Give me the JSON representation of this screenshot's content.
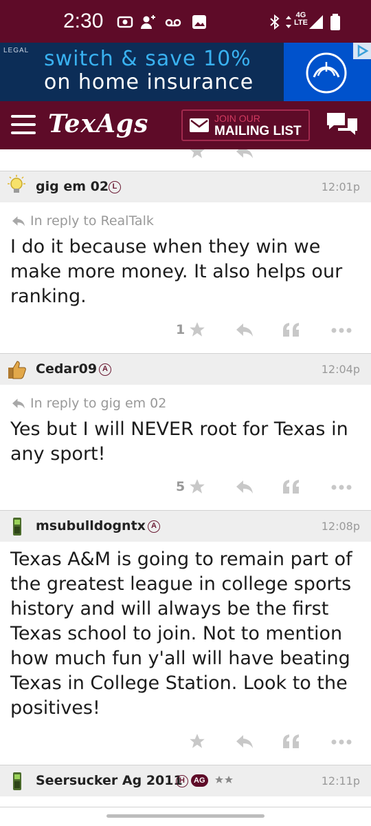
{
  "status_bar": {
    "time": "2:30",
    "network_label": "4G LTE",
    "icons": [
      "screen-record-icon",
      "person-add-icon",
      "voicemail-icon",
      "image-icon",
      "bluetooth-icon",
      "network-icon",
      "signal-icon",
      "battery-icon"
    ]
  },
  "ad": {
    "legal": "LEGAL",
    "line1": "switch & save 10%",
    "line2": "on home insurance",
    "brand_color": "#0052cc"
  },
  "nav": {
    "brand": "TexAgs",
    "mail_small": "JOIN OUR",
    "mail_big": "MAILING LIST",
    "bg_color": "#5e0b28"
  },
  "posts": [
    {
      "user": "gig em 02",
      "badge": "L",
      "time": "12:01p",
      "reply_to": "In reply to RealTalk",
      "body": "I do it because when they win we make more money. It also helps our ranking.",
      "stars": "1"
    },
    {
      "user": "Cedar09",
      "badge": "A",
      "time": "12:04p",
      "reply_to": "In reply to gig em 02",
      "body": "Yes but I will NEVER root for Texas in any sport!",
      "stars": "5"
    },
    {
      "user": "msubulldogntx",
      "badge": "A",
      "time": "12:08p",
      "body": "Texas A&M is going to remain part of the greatest league in college sports history and will always be the first Texas school to join. Not to mention how much fun y'all will have beating Texas in College Station. Look to the positives!",
      "stars": ""
    },
    {
      "user": "Seersucker Ag 2011",
      "badge": "H",
      "badge2": "AG",
      "time": "12:11p"
    }
  ]
}
